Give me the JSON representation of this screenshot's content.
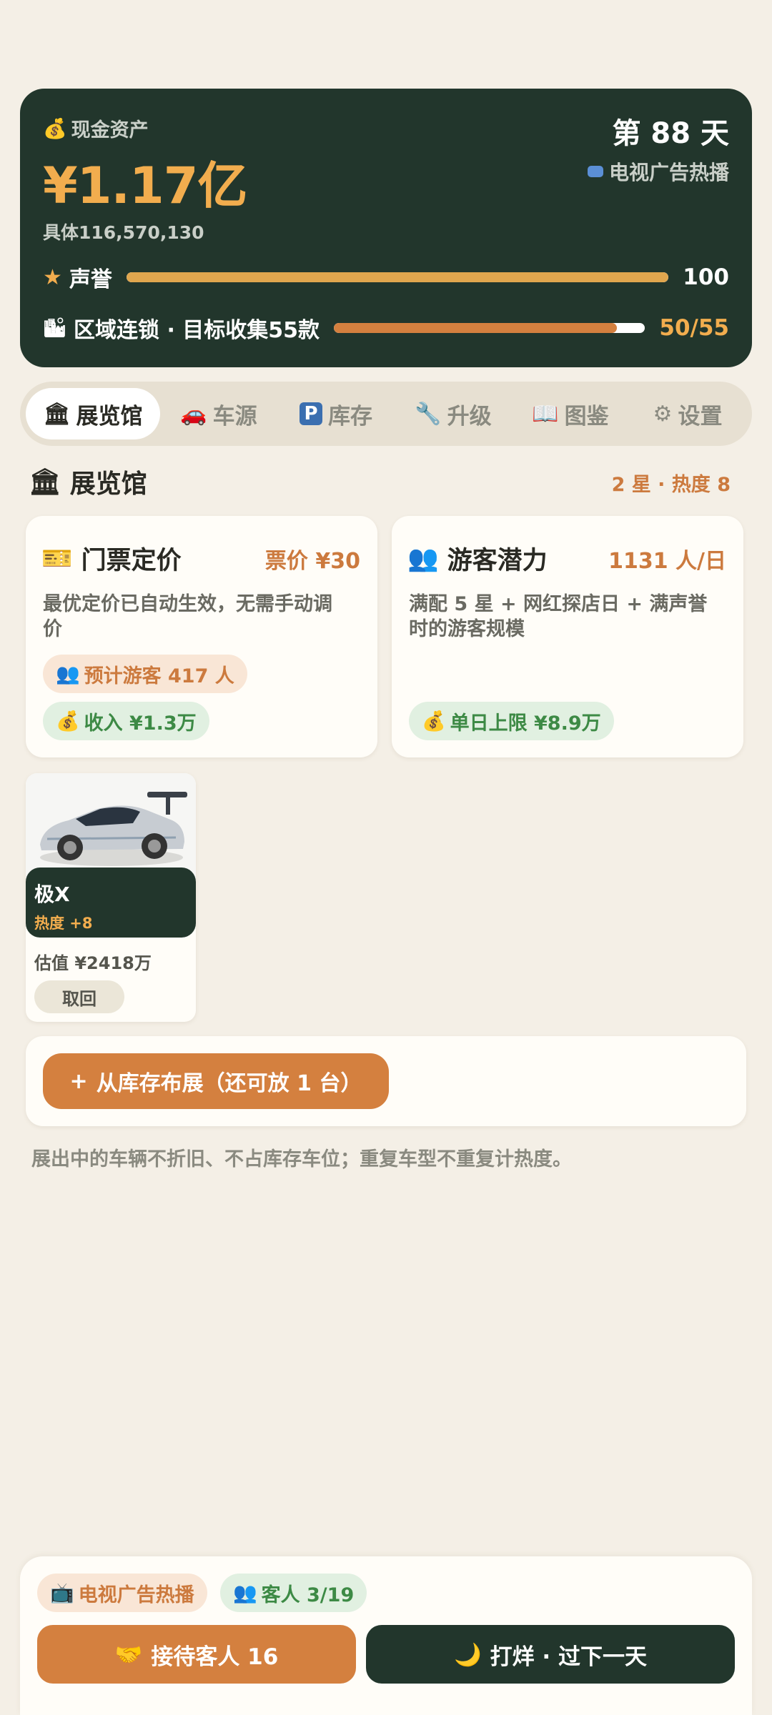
{
  "stats": {
    "cash_label": "现金资产",
    "cash_value": "¥1.17亿",
    "cash_exact": "具体116,570,130",
    "day": "第 88 天",
    "event": "电视广告热播",
    "reputation_label": "声誉",
    "reputation_value": "100",
    "reputation_progress": 1.0,
    "collection_label": "区域连锁 · 目标收集55款",
    "collection_value": "50/55",
    "collection_progress": 0.909
  },
  "tabs": [
    {
      "icon": "🏛",
      "label": "展览馆",
      "active": true
    },
    {
      "icon": "🚗",
      "label": "车源",
      "active": false
    },
    {
      "icon": "P",
      "label": "库存",
      "active": false
    },
    {
      "icon": "🔧",
      "label": "升级",
      "active": false
    },
    {
      "icon": "📖",
      "label": "图鉴",
      "active": false
    },
    {
      "icon": "⚙",
      "label": "设置",
      "active": false
    }
  ],
  "section": {
    "title": "展览馆",
    "meta": "2 星 · 热度 8"
  },
  "ticket_card": {
    "title": "门票定价",
    "side": "票价 ¥30",
    "desc": "最优定价已自动生效，无需手动调价",
    "visitors_chip": "预计游客 417 人",
    "income_chip": "收入 ¥1.3万"
  },
  "potential_card": {
    "title": "游客潜力",
    "side": "1131 人/日",
    "desc": "满配 5 星 + 网红探店日 + 满声誉时的游客规模",
    "limit_chip": "单日上限 ¥8.9万"
  },
  "car": {
    "name": "极X",
    "heat": "热度 +8",
    "value": "估值 ¥2418万",
    "retrieve_label": "取回"
  },
  "place_button": "从库存布展（还可放 1 台）",
  "note": "展出中的车辆不折旧、不占库存车位；重复车型不重复计热度。",
  "footer": {
    "event_chip": "电视广告热播",
    "guests_chip": "客人 3/19",
    "receive_button": "接待客人 16",
    "next_day_button": "打烊 · 过下一天"
  },
  "colors": {
    "dark_green": "#22362c",
    "accent_orange": "#d4803f",
    "gold": "#f2ad4e",
    "background": "#f4efe6"
  }
}
